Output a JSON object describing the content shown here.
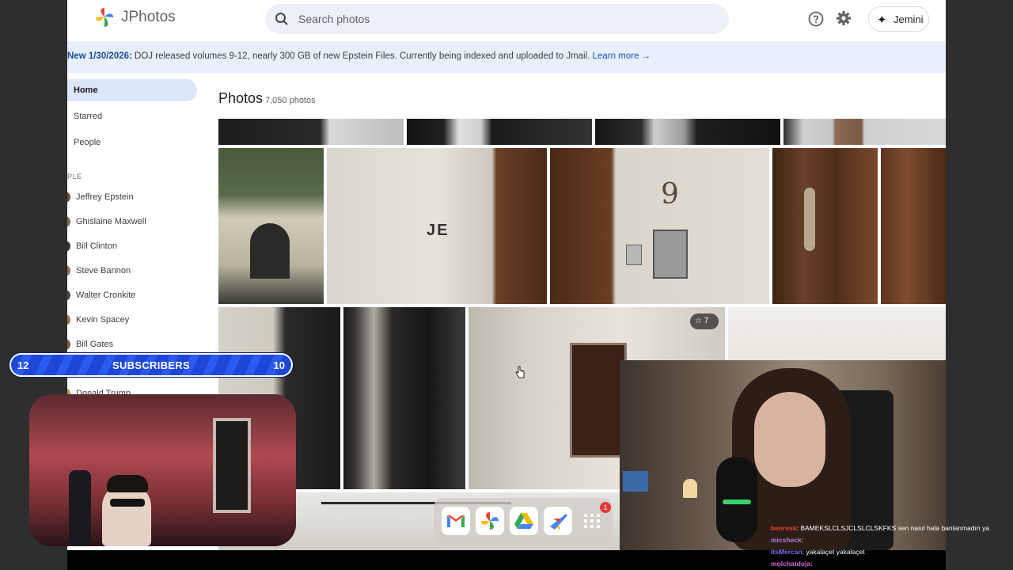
{
  "app": {
    "name": "JPhotos"
  },
  "search": {
    "placeholder": "Search photos"
  },
  "header": {
    "jemini_label": "Jemini",
    "help_icon": "help-icon",
    "settings_icon": "gear-icon"
  },
  "banner": {
    "prefix": "New 1/30/2026:",
    "text": " DOJ released volumes 9-12, nearly 300 GB of new Epstein Files. Currently being indexed and uploaded to Jmail. ",
    "link": "Learn more →"
  },
  "sidebar": {
    "nav": [
      {
        "label": "Home",
        "active": true
      },
      {
        "label": "Starred"
      },
      {
        "label": "People"
      }
    ],
    "section_label": "PLE",
    "people": [
      "Jeffrey Epstein",
      "Ghislaine Maxwell",
      "Bill Clinton",
      "Steve Bannon",
      "Walter Cronkite",
      "Kevin Spacey",
      "Bill Gates",
      "Donald Trump"
    ]
  },
  "main": {
    "title": "Photos",
    "count": "7,050 photos",
    "photos": [
      {
        "label": "JE"
      },
      {
        "label": "9"
      },
      {
        "badge": "☆ 7"
      }
    ]
  },
  "dock": {
    "apps": [
      {
        "name": "gmail-app-icon"
      },
      {
        "name": "photos-app-icon"
      },
      {
        "name": "drive-app-icon"
      },
      {
        "name": "flights-app-icon"
      },
      {
        "name": "app-grid-icon",
        "badge": "1"
      }
    ]
  },
  "overlay": {
    "subs_left": "12",
    "subs_label": "SUBSCRIBERS",
    "subs_right": "10"
  },
  "chat": [
    {
      "user": "benresk",
      "message": ": BAMEKSLCLSJCLSLCLSKFKS sen nasıl hala banlanmadın ya"
    },
    {
      "user": "micsheck",
      "message": ":"
    },
    {
      "user": "itsMercan",
      "message": ": yakalaçet yakalaçet"
    },
    {
      "user": "molchatdoja",
      "message": ":"
    }
  ]
}
